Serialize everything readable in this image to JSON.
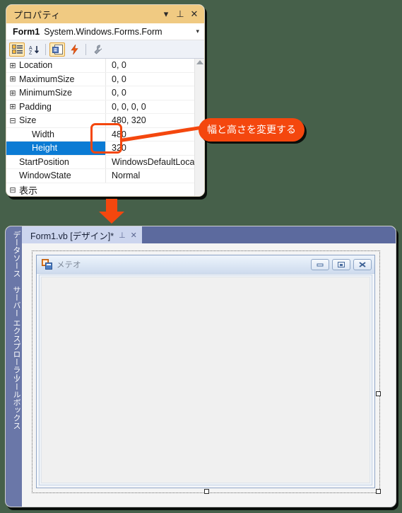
{
  "properties_panel": {
    "title": "プロパティ",
    "titlebar_icons": [
      {
        "name": "chevron-down-icon",
        "glyph": "▾"
      },
      {
        "name": "pin-icon",
        "glyph": "⊥"
      },
      {
        "name": "close-icon",
        "glyph": "✕"
      }
    ],
    "object_name": "Form1",
    "object_type": "System.Windows.Forms.Form",
    "object_dropdown_glyph": "▾",
    "toolbar": [
      {
        "name": "categorized-view-button",
        "active": true
      },
      {
        "name": "alphabetical-view-button",
        "active": false
      },
      {
        "name": "properties-page-button",
        "active": true
      },
      {
        "name": "events-button",
        "active": false
      },
      {
        "name": "property-pages-wrench-button",
        "active": false
      }
    ],
    "rows": [
      {
        "expander": "⊞",
        "name": "Location",
        "value": "0, 0",
        "indent": false,
        "selected": false
      },
      {
        "expander": "⊞",
        "name": "MaximumSize",
        "value": "0, 0",
        "indent": false,
        "selected": false
      },
      {
        "expander": "⊞",
        "name": "MinimumSize",
        "value": "0, 0",
        "indent": false,
        "selected": false
      },
      {
        "expander": "⊞",
        "name": "Padding",
        "value": "0, 0, 0, 0",
        "indent": false,
        "selected": false
      },
      {
        "expander": "⊟",
        "name": "Size",
        "value": "480, 320",
        "indent": false,
        "selected": false
      },
      {
        "expander": "",
        "name": "Width",
        "value": "480",
        "indent": true,
        "selected": false
      },
      {
        "expander": "",
        "name": "Height",
        "value": "320",
        "indent": true,
        "selected": true
      },
      {
        "expander": "",
        "name": "StartPosition",
        "value": "WindowsDefaultLocati",
        "indent": false,
        "selected": false
      },
      {
        "expander": "",
        "name": "WindowState",
        "value": "Normal",
        "indent": false,
        "selected": false
      }
    ],
    "category_row": {
      "expander": "⊟",
      "name": "表示"
    },
    "scrollbar": {
      "name": "properties-scrollbar",
      "up_arrow": "▲"
    }
  },
  "callout": {
    "text": "幅と高さを変更する",
    "color": "#f4470e"
  },
  "flow_arrow": {
    "name": "down-arrow",
    "color": "#f4470e"
  },
  "ide": {
    "sidebar_labels": [
      "データソース",
      "サーバー エクスプローラー",
      "ツールボックス"
    ],
    "tab": {
      "label": "Form1.vb [デザイン]*",
      "pin_glyph": "⊥",
      "close_glyph": "✕"
    },
    "form": {
      "title": "メテオ",
      "buttons": [
        {
          "name": "minimize-button",
          "glyph": "▬"
        },
        {
          "name": "maximize-button",
          "glyph": "▣"
        },
        {
          "name": "close-button",
          "glyph": "✖"
        }
      ]
    }
  },
  "colors": {
    "background": "#46604a",
    "accent_orange": "#f4470e",
    "panel_title": "#f0ca82",
    "selection_blue": "#0b7bd4",
    "ide_chrome": "#5c6a9e"
  }
}
